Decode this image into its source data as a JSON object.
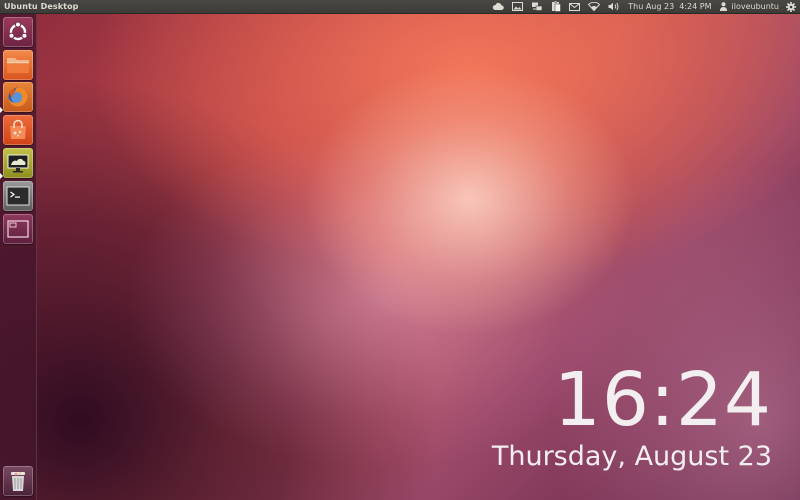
{
  "top_panel": {
    "window_title": "Ubuntu Desktop",
    "indicators": {
      "cloud_icon": "cloud-icon",
      "photo_icon": "photo-icon",
      "network_icon": "network-icon",
      "clipboard_icon": "clipboard-icon",
      "mail_icon": "mail-icon",
      "wifi_icon": "wifi-icon",
      "volume_icon": "volume-icon",
      "clock": "Thu Aug 23  4:24 PM",
      "user_icon": "user-icon",
      "user_name": "iloveubuntu",
      "session_icon": "gear-icon"
    }
  },
  "launcher": {
    "items": [
      {
        "name": "dash-home",
        "icon": "ubuntu-logo-icon",
        "running": false
      },
      {
        "name": "home-folder",
        "icon": "folder-icon",
        "running": false
      },
      {
        "name": "firefox",
        "icon": "firefox-icon",
        "running": true
      },
      {
        "name": "ubuntu-software-center",
        "icon": "shopping-bag-icon",
        "running": false
      },
      {
        "name": "remote-desktop",
        "icon": "monitor-icon",
        "running": true
      },
      {
        "name": "terminal",
        "icon": "terminal-icon",
        "running": false
      },
      {
        "name": "workspace-switcher",
        "icon": "workspace-icon",
        "running": false
      }
    ],
    "trash": {
      "icon": "trash-icon"
    }
  },
  "desktop_clock": {
    "time": "16:24",
    "date": "Thursday, August 23"
  },
  "colors": {
    "panel_bg": "#3c3b37",
    "panel_text": "#dfdbd2",
    "launcher_bg": "#46162c",
    "ubuntu_orange": "#dd4814"
  }
}
